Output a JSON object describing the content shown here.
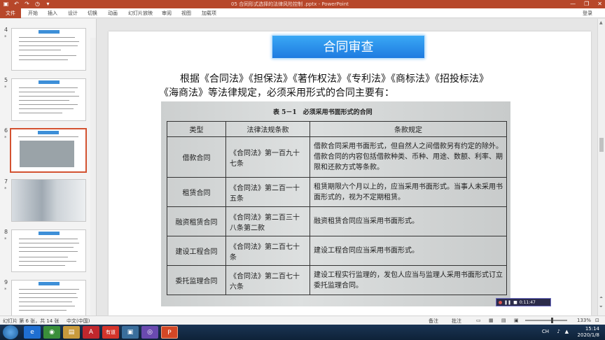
{
  "window": {
    "title": "05 合同形式选择的法律风险控制 .pptx - PowerPoint",
    "minimize": "—",
    "restore": "❐",
    "close": "✕"
  },
  "quick_access": [
    "▣",
    "↶",
    "↷",
    "◷",
    "▾"
  ],
  "ribbon": {
    "file_tab": "文件",
    "tabs": [
      "开始",
      "插入",
      "设计",
      "切换",
      "动画",
      "幻灯片放映",
      "审阅",
      "视图",
      "加载项"
    ],
    "login": "登录"
  },
  "thumbnails": [
    {
      "num": "4",
      "star": "*"
    },
    {
      "num": "5",
      "star": "*"
    },
    {
      "num": "6",
      "star": "*",
      "selected": true
    },
    {
      "num": "7",
      "star": "*"
    },
    {
      "num": "8",
      "star": "*"
    },
    {
      "num": "9",
      "star": "*"
    }
  ],
  "slide": {
    "title": "合同审查",
    "body_line1": "根据《合同法》《担保法》《著作权法》《专利法》《商标法》《招投标法》",
    "body_line2": "《海商法》等法律规定，必须采用形式的合同主要有："
  },
  "book_table": {
    "caption": "表 5－1　必须采用书面形式的合同",
    "headers": [
      "类型",
      "法律法规条款",
      "条款规定"
    ],
    "rows": [
      [
        "借款合同",
        "《合同法》第一百九十七条",
        "借款合同采用书面形式，但自然人之间借款另有约定的除外。借款合同的内容包括借款种类、币种、用途、数额、利率、期限和还款方式等条款。"
      ],
      [
        "租赁合同",
        "《合同法》第二百一十五条",
        "租赁期限六个月以上的，应当采用书面形式。当事人未采用书面形式的，视为不定期租赁。"
      ],
      [
        "融资租赁合同",
        "《合同法》第二百三十八条第二款",
        "融资租赁合同应当采用书面形式。"
      ],
      [
        "建设工程合同",
        "《合同法》第二百七十条",
        "建设工程合同应当采用书面形式。"
      ],
      [
        "委托监理合同",
        "《合同法》第二百七十六条",
        "建设工程实行监理的，发包人应当与监理人采用书面形式订立委托监理合同。"
      ]
    ]
  },
  "recorder": {
    "time": "0:11:47"
  },
  "status_bar": {
    "slide_info": "幻灯片 第 6 张，共 14 张",
    "language": "中文(中国)",
    "notes": "备注",
    "comments": "批注",
    "zoom": "133%"
  },
  "taskbar": {
    "apps": [
      "e",
      "◉",
      "▤",
      "A",
      "有道",
      "▣",
      "◎",
      "P"
    ],
    "tray_lang": "CH",
    "time": "15:14",
    "date": "2020/1/8"
  },
  "colors": {
    "accent": "#b7472a",
    "title_box": "#1e7be0"
  }
}
